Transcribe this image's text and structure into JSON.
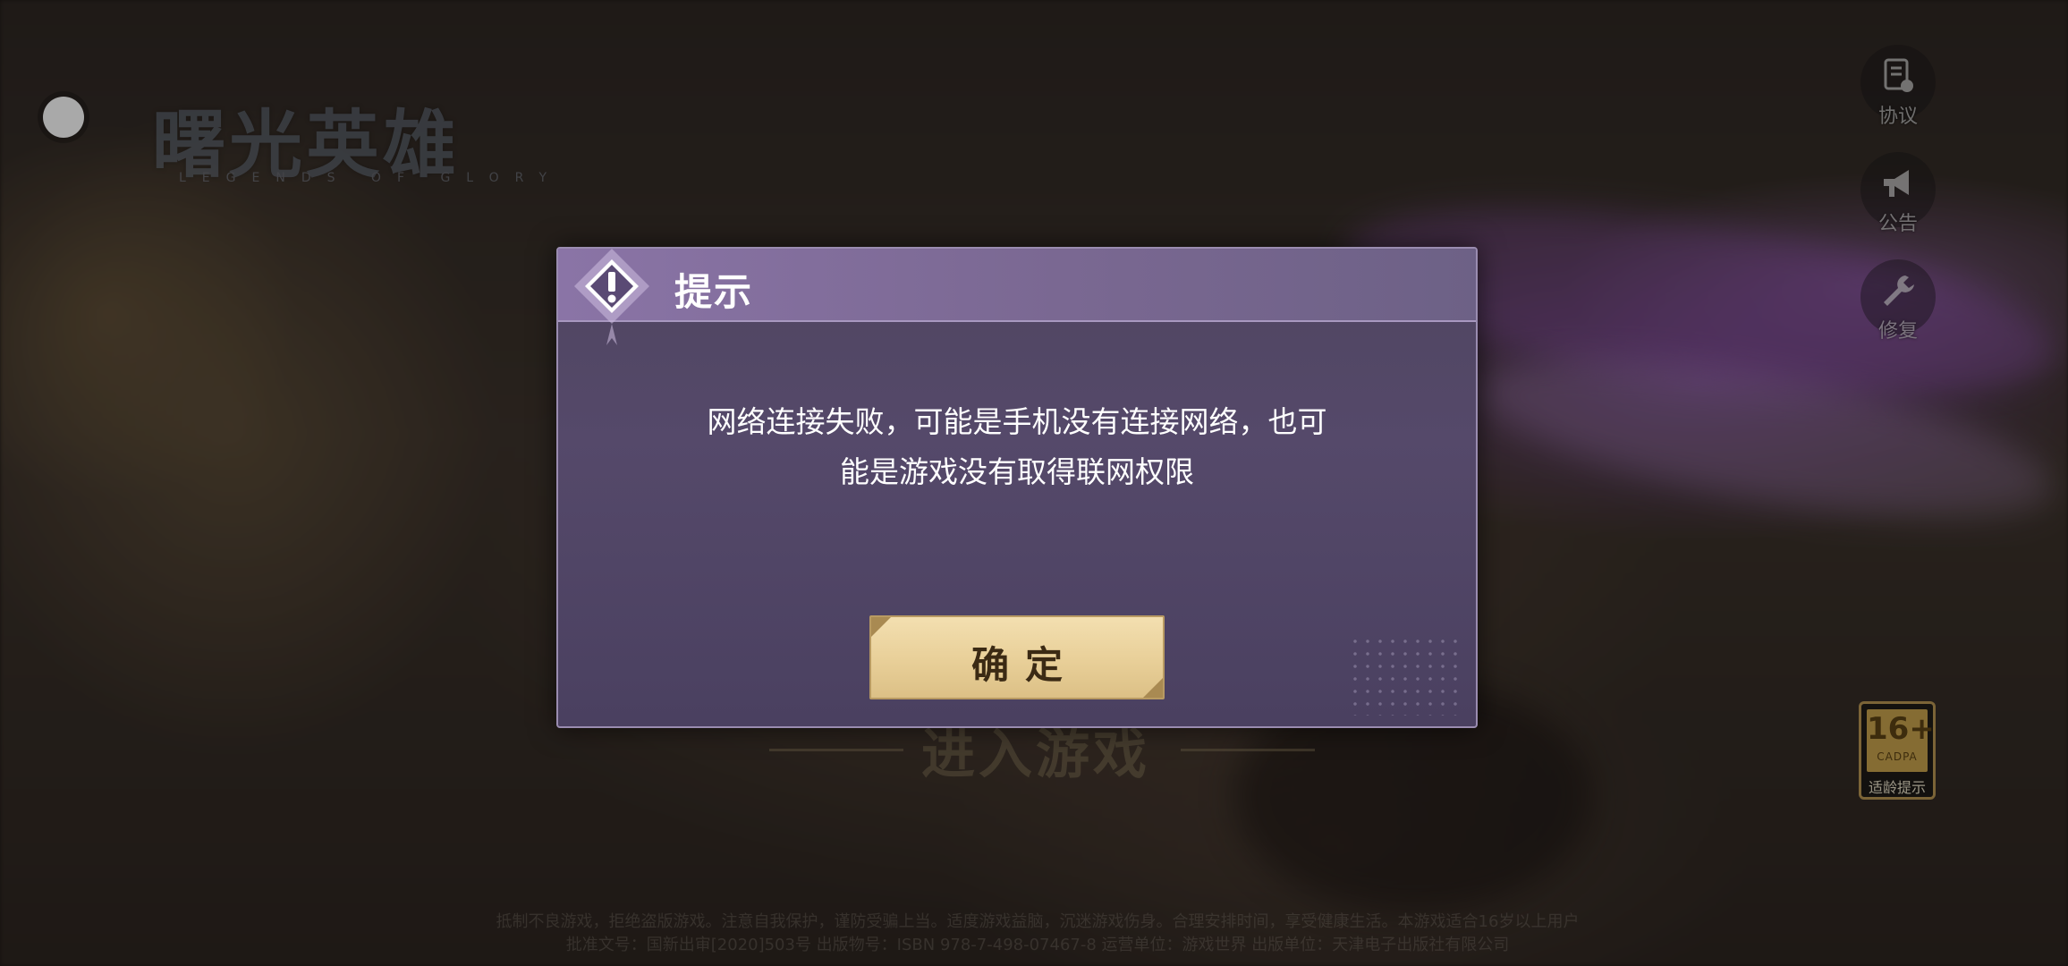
{
  "game": {
    "logo_title": "曙光英雄",
    "logo_subtitle": "LEGENDS OF GLORY"
  },
  "side_menu": [
    {
      "label": "协议",
      "icon": "document-icon"
    },
    {
      "label": "公告",
      "icon": "megaphone-icon"
    },
    {
      "label": "修复",
      "icon": "wrench-icon"
    }
  ],
  "enter_game_label": "进入游戏",
  "age_rating": {
    "age": "16+",
    "org": "CADPA",
    "caption": "适龄提示"
  },
  "footer": {
    "line1": "抵制不良游戏，拒绝盗版游戏。注意自我保护，谨防受骗上当。适度游戏益脑，沉迷游戏伤身。合理安排时间，享受健康生活。本游戏适合16岁以上用户",
    "line2": "批准文号：国新出审[2020]503号 出版物号：ISBN 978-7-498-07467-8 运营单位：游戏世界 出版单位：天津电子出版社有限公司"
  },
  "dialog": {
    "title": "提示",
    "message_line1": "网络连接失败，可能是手机没有连接网络，也可",
    "message_line2": "能是游戏没有取得联网权限",
    "confirm_label": "确定"
  },
  "colors": {
    "dialog_header": "#8a74a6",
    "dialog_body": "#4f4560",
    "confirm_button": "#e8cf98",
    "confirm_text": "#3b2a14"
  }
}
